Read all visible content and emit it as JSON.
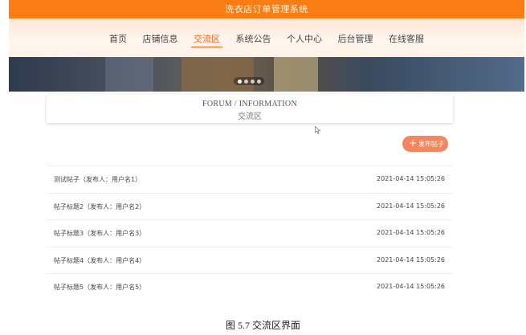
{
  "app": {
    "title": "洗衣店订单管理系统"
  },
  "nav": {
    "items": [
      {
        "label": "首页"
      },
      {
        "label": "店铺信息"
      },
      {
        "label": "交流区"
      },
      {
        "label": "系统公告"
      },
      {
        "label": "个人中心"
      },
      {
        "label": "后台管理"
      },
      {
        "label": "在线客服"
      }
    ],
    "active_index": 2
  },
  "carousel": {
    "slide_count": 4,
    "active_slide": 1
  },
  "section": {
    "title_en": "FORUM / INFORMATION",
    "title_cn": "交流区"
  },
  "post_button": {
    "icon": "plus-icon",
    "label": "发布帖子"
  },
  "posts": [
    {
      "title": "测试帖子（发布人：用户名1）",
      "date": "2021-04-14 15:05:26"
    },
    {
      "title": "帖子标题2（发布人：用户名2）",
      "date": "2021-04-14 15:05:26"
    },
    {
      "title": "帖子标题3（发布人：用户名3）",
      "date": "2021-04-14 15:05:26"
    },
    {
      "title": "帖子标题4（发布人：用户名4）",
      "date": "2021-04-14 15:05:26"
    },
    {
      "title": "帖子标题5（发布人：用户名5）",
      "date": "2021-04-14 15:05:26"
    }
  ],
  "caption": "图 5.7 交流区界面",
  "colors": {
    "topbar": "#f97d12",
    "accent": "#f06a1c",
    "button": "#f2865e"
  }
}
